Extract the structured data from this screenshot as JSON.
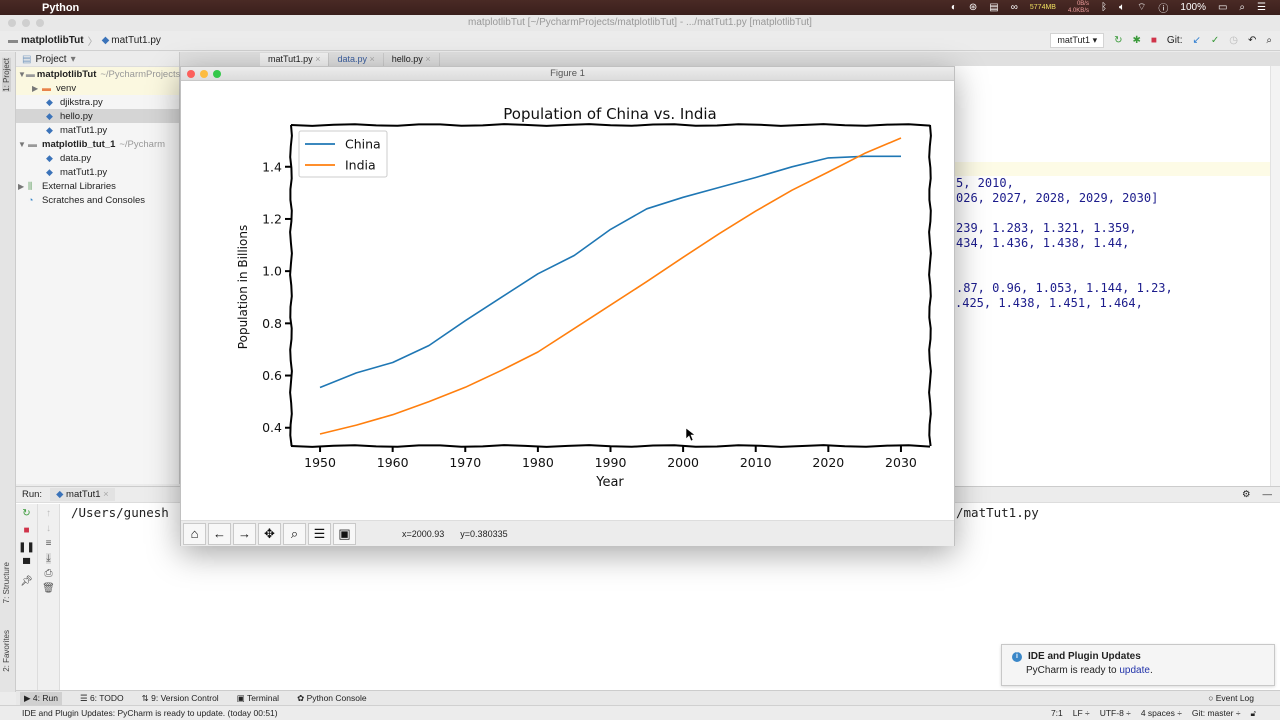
{
  "menubar": {
    "app_name": "Python",
    "memory": "5774MB",
    "net_up": "0B/s",
    "net_down": "4.0KB/s",
    "battery": "100%"
  },
  "window_title": "matplotlibTut [~/PycharmProjects/matplotlibTut] - .../matTut1.py [matplotlibTut]",
  "navbar": {
    "crumbs": [
      "matplotlibTut",
      "matTut1.py"
    ],
    "run_config": "matTut1",
    "git_label": "Git:"
  },
  "sidebar_labels": {
    "project": "1: Project",
    "structure": "7: Structure",
    "favorites": "2: Favorites"
  },
  "project_panel": {
    "title": "Project",
    "items": [
      {
        "label": "matplotlibTut",
        "path": "~/PycharmProjects",
        "type": "root"
      },
      {
        "label": "venv",
        "type": "folder"
      },
      {
        "label": "djikstra.py",
        "type": "file"
      },
      {
        "label": "hello.py",
        "type": "file"
      },
      {
        "label": "matTut1.py",
        "type": "file"
      },
      {
        "label": "matplotlib_tut_1",
        "path": "~/Pycharm",
        "type": "root"
      },
      {
        "label": "data.py",
        "type": "file"
      },
      {
        "label": "matTut1.py",
        "type": "file"
      },
      {
        "label": "External Libraries",
        "type": "lib"
      },
      {
        "label": "Scratches and Consoles",
        "type": "scratch"
      }
    ]
  },
  "editor_tabs": [
    "matTut1.py",
    "data.py",
    "hello.py"
  ],
  "code_lines": [
    "5, 2010,",
    "026, 2027, 2028, 2029, 2030]",
    "239, 1.283, 1.321, 1.359,",
    "434, 1.436, 1.438, 1.44,",
    ".87, 0.96, 1.053, 1.144, 1.23,",
    ".425, 1.438, 1.451, 1.464,"
  ],
  "run_panel": {
    "label": "Run:",
    "tab": "matTut1",
    "console_left": "/Users/gunesh",
    "console_right": "/matTut1.py"
  },
  "figure": {
    "window_title": "Figure 1",
    "coords": {
      "x": "x=2000.93",
      "y": "y=0.380335"
    },
    "toolbar": [
      "home-icon",
      "back-icon",
      "forward-icon",
      "pan-icon",
      "zoom-icon",
      "configure-icon",
      "save-icon"
    ]
  },
  "chart_data": {
    "type": "line",
    "title": "Population of China vs. India",
    "xlabel": "Year",
    "ylabel": "Population in Billions",
    "x": [
      1950,
      1955,
      1960,
      1965,
      1970,
      1975,
      1980,
      1985,
      1990,
      1995,
      2000,
      2005,
      2010,
      2015,
      2020,
      2025,
      2030
    ],
    "series": [
      {
        "name": "China",
        "color": "#1f77b4",
        "values": [
          0.554,
          0.61,
          0.65,
          0.715,
          0.81,
          0.9,
          0.99,
          1.06,
          1.16,
          1.239,
          1.283,
          1.321,
          1.359,
          1.4,
          1.434,
          1.44,
          1.44
        ]
      },
      {
        "name": "India",
        "color": "#ff7f0e",
        "values": [
          0.376,
          0.41,
          0.45,
          0.5,
          0.555,
          0.62,
          0.69,
          0.78,
          0.87,
          0.96,
          1.053,
          1.144,
          1.23,
          1.31,
          1.38,
          1.451,
          1.51
        ]
      }
    ],
    "xticks": [
      "1950",
      "1960",
      "1970",
      "1980",
      "1990",
      "2000",
      "2010",
      "2020",
      "2030"
    ],
    "yticks": [
      "0.4",
      "0.6",
      "0.8",
      "1.0",
      "1.2",
      "1.4"
    ],
    "xlim": [
      1946,
      2034
    ],
    "ylim": [
      0.33,
      1.56
    ],
    "legend": "top-left",
    "grid": false
  },
  "tool_windows": [
    "4: Run",
    "6: TODO",
    "9: Version Control",
    "Terminal",
    "Python Console"
  ],
  "notification": {
    "title": "IDE and Plugin Updates",
    "body": "PyCharm is ready to ",
    "link": "update",
    "end": "."
  },
  "event_log": "Event Log",
  "status": {
    "message": "IDE and Plugin Updates: PyCharm is ready to update. (today 00:51)",
    "position": "7:1",
    "line_sep": "LF ÷",
    "encoding": "UTF-8 ÷",
    "indent": "4 spaces ÷",
    "branch": "Git: master ÷"
  }
}
